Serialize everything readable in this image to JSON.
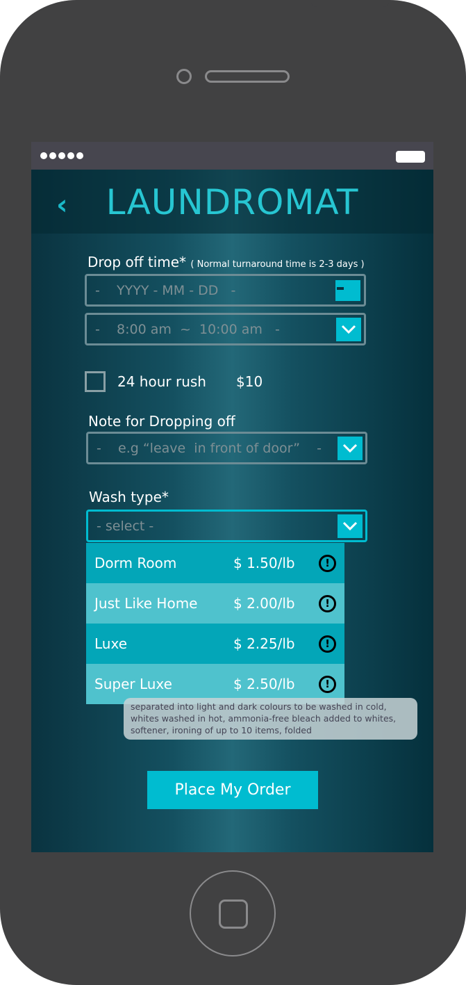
{
  "app": {
    "title": "LAUNDROMAT"
  },
  "dropoff": {
    "label": "Drop off time*",
    "note": "( Normal turnaround time is 2-3 days )",
    "date_placeholder": "-    YYYY - MM - DD   -",
    "time_value": "-    8:00 am  ~  10:00 am   -"
  },
  "rush": {
    "label": "24 hour rush",
    "price": "$10",
    "checked": false
  },
  "note": {
    "label": "Note for Dropping off",
    "placeholder": "-    e.g “leave  in front of door”    -"
  },
  "wash": {
    "label": "Wash type*",
    "placeholder": "- select -",
    "options": [
      {
        "name": "Dorm Room",
        "price": "$ 1.50/lb"
      },
      {
        "name": "Just Like Home",
        "price": "$ 2.00/lb"
      },
      {
        "name": "Luxe",
        "price": "$ 2.25/lb"
      },
      {
        "name": "Super Luxe",
        "price": "$ 2.50/lb"
      }
    ],
    "info_glyph": "!",
    "tooltip": "separated into light and dark colours to be washed in cold, whites washed in hot, ammonia-free bleach added to whites, softener, ironing of up to 10 items, folded"
  },
  "order_button": "Place My Order",
  "colors": {
    "accent": "#00bcd0",
    "option_dark": "#03a6b8",
    "option_light": "#4fc2cd"
  }
}
